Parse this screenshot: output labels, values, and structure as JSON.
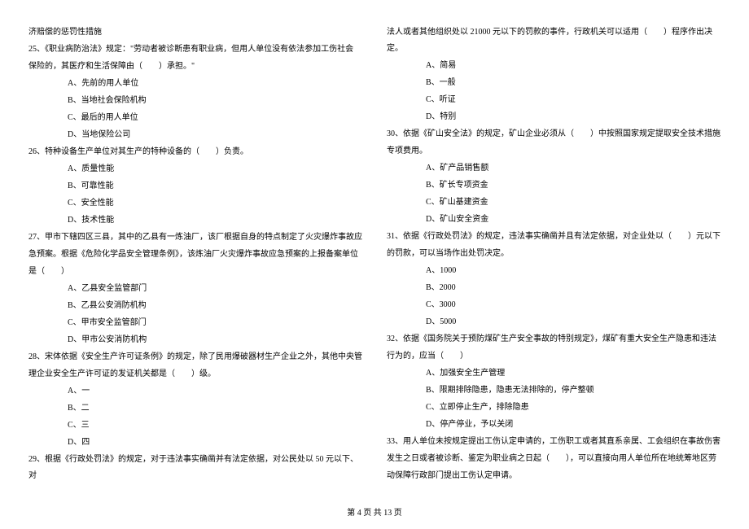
{
  "left_column": {
    "line0": "济赔偿的惩罚性措施",
    "q25": {
      "stem1": "25、《职业病防治法》规定：\"劳动者被诊断患有职业病，但用人单位没有依法参加工伤社会",
      "stem2": "保险的，其医疗和生活保障由（　　）承担。\"",
      "optA": "A、先前的用人单位",
      "optB": "B、当地社会保险机构",
      "optC": "C、最后的用人单位",
      "optD": "D、当地保险公司"
    },
    "q26": {
      "stem": "26、特种设备生产单位对其生产的特种设备的（　　）负责。",
      "optA": "A、质量性能",
      "optB": "B、可靠性能",
      "optC": "C、安全性能",
      "optD": "D、技术性能"
    },
    "q27": {
      "stem1": "27、甲市下辖四区三县，其中的乙县有一炼油厂，该厂根据自身的特点制定了火灾爆炸事故应",
      "stem2": "急预案。根据《危险化学品安全管理条例》，该炼油厂火灾爆炸事故应急预案的上报备案单位",
      "stem3": "是（　　）",
      "optA": "A、乙县安全监管部门",
      "optB": "B、乙县公安消防机构",
      "optC": "C、甲市安全监管部门",
      "optD": "D、甲市公安消防机构"
    },
    "q28": {
      "stem1": "28、宋体依据《安全生产许可证条例》的规定，除了民用爆破器材生产企业之外，其他中央管",
      "stem2": "理企业安全生产许可证的发证机关都是（　　）级。",
      "optA": "A、一",
      "optB": "B、二",
      "optC": "C、三",
      "optD": "D、四"
    },
    "q29": {
      "stem": "29、根据《行政处罚法》的规定，对于违法事实确凿并有法定依据，对公民处以 50 元以下、对"
    }
  },
  "right_column": {
    "q29_cont": {
      "stem": "法人或者其他组织处以 21000 元以下的罚款的事件，行政机关可以适用（　　）程序作出决定。",
      "optA": "A、简易",
      "optB": "B、一般",
      "optC": "C、听证",
      "optD": "D、特别"
    },
    "q30": {
      "stem1": "30、依据《矿山安全法》的规定，矿山企业必须从（　　）中按照国家规定提取安全技术措施",
      "stem2": "专项费用。",
      "optA": "A、矿产品销售额",
      "optB": "B、矿长专项资金",
      "optC": "C、矿山基建资金",
      "optD": "D、矿山安全资金"
    },
    "q31": {
      "stem1": "31、依据《行政处罚法》的规定，违法事实确凿并且有法定依据，对企业处以（　　）元以下",
      "stem2": "的罚款，可以当场作出处罚决定。",
      "optA": "A、1000",
      "optB": "B、2000",
      "optC": "C、3000",
      "optD": "D、5000"
    },
    "q32": {
      "stem1": "32、依据《国务院关于预防煤矿生产安全事故的特别规定》，煤矿有重大安全生产隐患和违法",
      "stem2": "行为的，应当（　　）",
      "optA": "A、加强安全生产管理",
      "optB": "B、限期排除隐患，隐患无法排除的，停产整顿",
      "optC": "C、立即停止生产，排除隐患",
      "optD": "D、停产停业，予以关闭"
    },
    "q33": {
      "stem1": "33、用人单位未按规定提出工伤认定申请的，工伤职工或者其直系亲属、工会组织在事故伤害",
      "stem2": "发生之日或者被诊断、鉴定为职业病之日起（　　），可以直接向用人单位所在地统筹地区劳",
      "stem3": "动保障行政部门提出工伤认定申请。"
    }
  },
  "footer": "第 4 页 共 13 页"
}
